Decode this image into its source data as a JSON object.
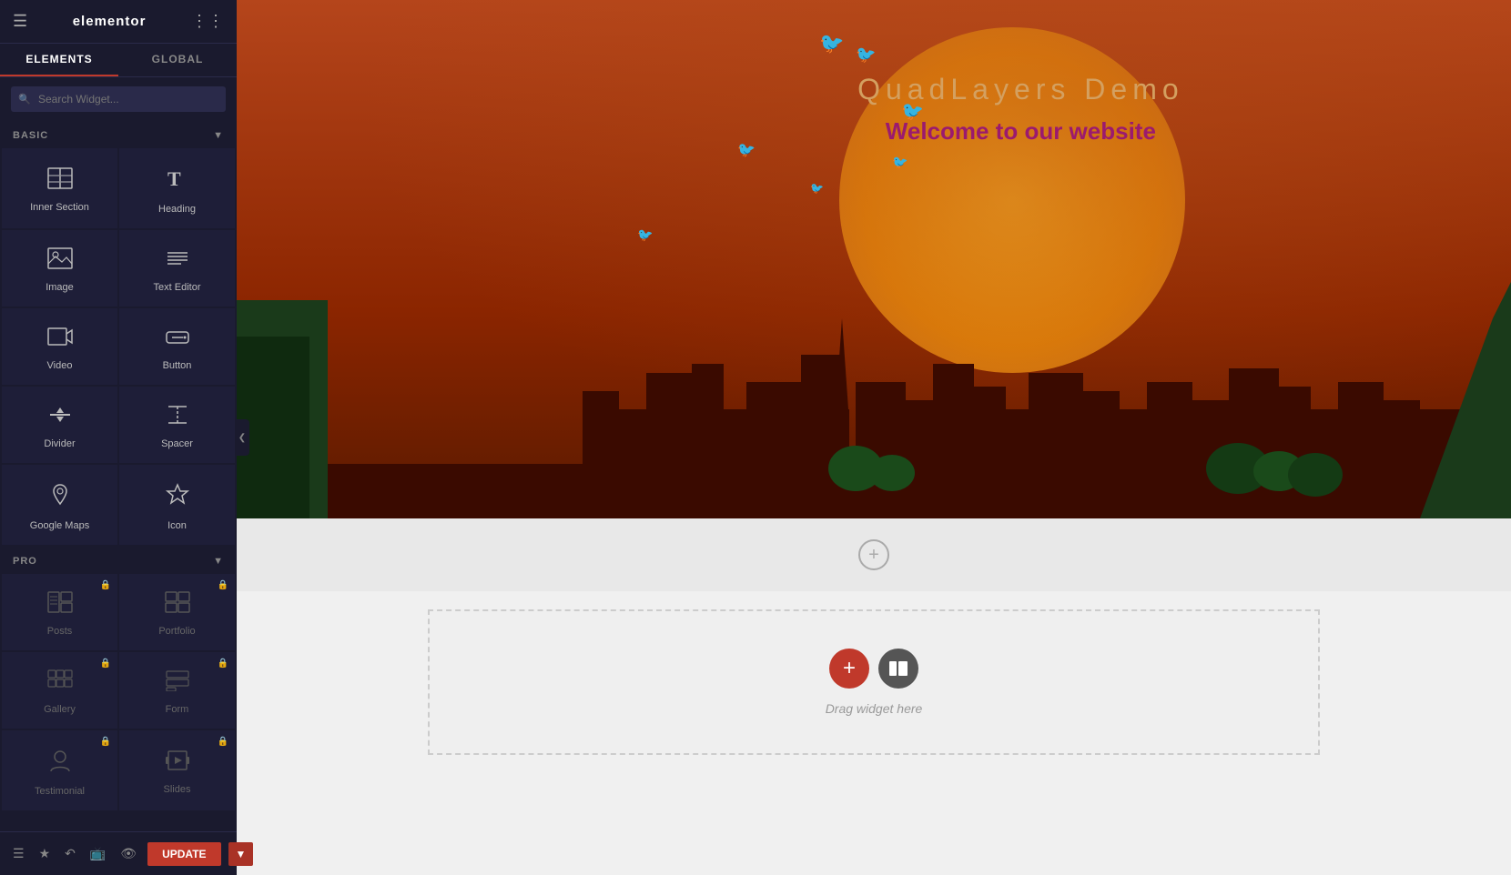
{
  "sidebar": {
    "logo": "elementor",
    "tabs": [
      {
        "id": "elements",
        "label": "ELEMENTS",
        "active": true
      },
      {
        "id": "global",
        "label": "GLOBAL",
        "active": false
      }
    ],
    "search": {
      "placeholder": "Search Widget..."
    },
    "sections": [
      {
        "id": "basic",
        "label": "BASIC",
        "expanded": true,
        "widgets": [
          {
            "id": "inner-section",
            "label": "Inner Section",
            "icon": "inner-section-icon",
            "pro": false
          },
          {
            "id": "heading",
            "label": "Heading",
            "icon": "heading-icon",
            "pro": false
          },
          {
            "id": "image",
            "label": "Image",
            "icon": "image-icon",
            "pro": false
          },
          {
            "id": "text-editor",
            "label": "Text Editor",
            "icon": "text-editor-icon",
            "pro": false
          },
          {
            "id": "video",
            "label": "Video",
            "icon": "video-icon",
            "pro": false
          },
          {
            "id": "button",
            "label": "Button",
            "icon": "button-icon",
            "pro": false
          },
          {
            "id": "divider",
            "label": "Divider",
            "icon": "divider-icon",
            "pro": false
          },
          {
            "id": "spacer",
            "label": "Spacer",
            "icon": "spacer-icon",
            "pro": false
          },
          {
            "id": "google-maps",
            "label": "Google Maps",
            "icon": "google-maps-icon",
            "pro": false
          },
          {
            "id": "icon",
            "label": "Icon",
            "icon": "icon-widget-icon",
            "pro": false
          }
        ]
      },
      {
        "id": "pro",
        "label": "PRO",
        "expanded": true,
        "widgets": [
          {
            "id": "posts",
            "label": "Posts",
            "icon": "posts-icon",
            "pro": true
          },
          {
            "id": "portfolio",
            "label": "Portfolio",
            "icon": "portfolio-icon",
            "pro": true
          },
          {
            "id": "gallery",
            "label": "Gallery",
            "icon": "gallery-icon",
            "pro": true
          },
          {
            "id": "form",
            "label": "Form",
            "icon": "form-icon",
            "pro": true
          },
          {
            "id": "testimonial",
            "label": "Testimonial",
            "icon": "testimonial-icon",
            "pro": true
          },
          {
            "id": "slides",
            "label": "Slides",
            "icon": "slides-icon",
            "pro": true
          }
        ]
      }
    ],
    "footer": {
      "update_label": "UPDATE",
      "update_arrow": "▼"
    }
  },
  "canvas": {
    "hero": {
      "title": "QuadLayers Demo",
      "subtitle": "Welcome to our website"
    },
    "empty_section": {
      "drag_hint": "Drag widget here"
    }
  }
}
